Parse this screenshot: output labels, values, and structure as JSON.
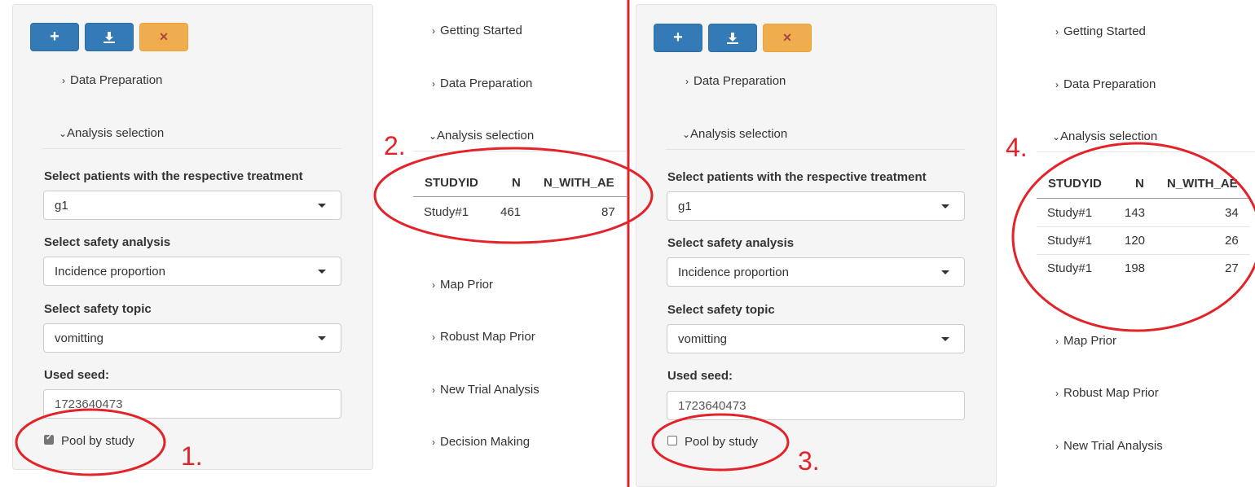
{
  "panel1": {
    "nav": [
      "Data Preparation",
      "Analysis selection"
    ],
    "treatment_label": "Select patients with the respective treatment",
    "treatment_value": "g1",
    "analysis_label": "Select safety analysis",
    "analysis_value": "Incidence proportion",
    "topic_label": "Select safety topic",
    "topic_value": "vomitting",
    "seed_label": "Used seed:",
    "seed_value": "1723640473",
    "pool_label": "Pool by study",
    "pool_checked": true
  },
  "main1": {
    "nav": [
      "Getting Started",
      "Data Preparation",
      "Analysis selection",
      "Map Prior",
      "Robust Map Prior",
      "New Trial Analysis",
      "Decision Making"
    ],
    "table": {
      "headers": [
        "STUDYID",
        "N",
        "N_WITH_AE"
      ],
      "rows": [
        [
          "Study#1",
          "461",
          "87"
        ]
      ]
    }
  },
  "panel2": {
    "nav": [
      "Data Preparation",
      "Analysis selection"
    ],
    "treatment_label": "Select patients with the respective treatment",
    "treatment_value": "g1",
    "analysis_label": "Select safety analysis",
    "analysis_value": "Incidence proportion",
    "topic_label": "Select safety topic",
    "topic_value": "vomitting",
    "seed_label": "Used seed:",
    "seed_value": "1723640473",
    "pool_label": "Pool by study",
    "pool_checked": false
  },
  "main2": {
    "nav": [
      "Getting Started",
      "Data Preparation",
      "Analysis selection",
      "Map Prior",
      "Robust Map Prior",
      "New Trial Analysis"
    ],
    "table": {
      "headers": [
        "STUDYID",
        "N",
        "N_WITH_AE"
      ],
      "rows": [
        [
          "Study#1",
          "143",
          "34"
        ],
        [
          "Study#1",
          "120",
          "26"
        ],
        [
          "Study#1",
          "198",
          "27"
        ]
      ]
    }
  },
  "annotations": [
    "1.",
    "2.",
    "3.",
    "4."
  ],
  "icons": {
    "add": "plus-icon",
    "download": "download-icon",
    "remove": "close-icon"
  },
  "colors": {
    "primary": "#337ab7",
    "warning": "#f0ad4e",
    "annotation": "#e32229"
  }
}
